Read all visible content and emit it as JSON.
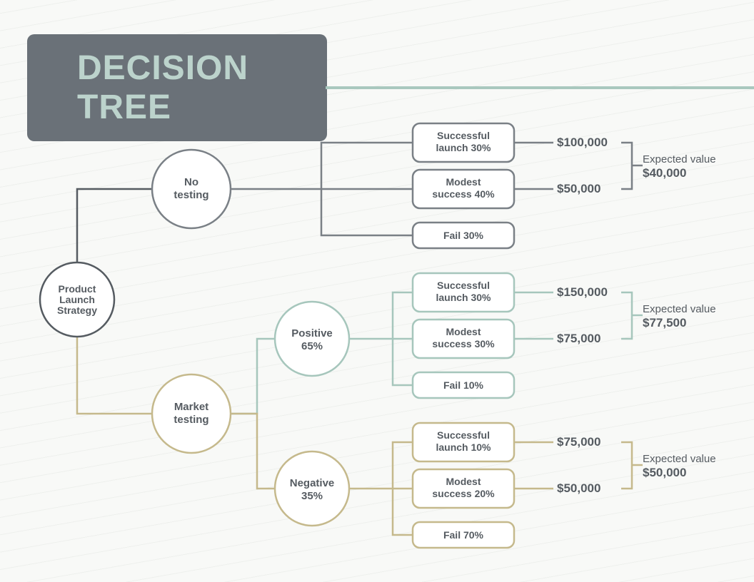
{
  "title": "DECISION TREE",
  "root": {
    "label": [
      "Product",
      "Launch",
      "Strategy"
    ]
  },
  "branches": {
    "notest": {
      "label": [
        "No",
        "testing"
      ],
      "outcomes": [
        {
          "k": "sl",
          "lines": [
            "Successful",
            "launch"
          ],
          "pct": "30%",
          "value": "$100,000"
        },
        {
          "k": "ms",
          "lines": [
            "Modest",
            "success"
          ],
          "pct": "40%",
          "value": "$50,000"
        },
        {
          "k": "fl",
          "lines": [
            "Fail"
          ],
          "pct": "30%",
          "value": ""
        }
      ],
      "ev": {
        "label": "Expected value",
        "value": "$40,000"
      }
    },
    "market": {
      "label": [
        "Market",
        "testing"
      ],
      "positive": {
        "label": "Positive",
        "pct": "65%",
        "outcomes": [
          {
            "k": "sl",
            "lines": [
              "Successful",
              "launch"
            ],
            "pct": "30%",
            "value": "$150,000"
          },
          {
            "k": "ms",
            "lines": [
              "Modest",
              "success"
            ],
            "pct": "30%",
            "value": "$75,000"
          },
          {
            "k": "fl",
            "lines": [
              "Fail"
            ],
            "pct": "10%",
            "value": ""
          }
        ],
        "ev": {
          "label": "Expected value",
          "value": "$77,500"
        }
      },
      "negative": {
        "label": "Negative",
        "pct": "35%",
        "outcomes": [
          {
            "k": "sl",
            "lines": [
              "Successful",
              "launch"
            ],
            "pct": "10%",
            "value": "$75,000"
          },
          {
            "k": "ms",
            "lines": [
              "Modest",
              "success"
            ],
            "pct": "20%",
            "value": "$50,000"
          },
          {
            "k": "fl",
            "lines": [
              "Fail"
            ],
            "pct": "70%",
            "value": ""
          }
        ],
        "ev": {
          "label": "Expected value",
          "value": "$50,000"
        }
      }
    }
  }
}
